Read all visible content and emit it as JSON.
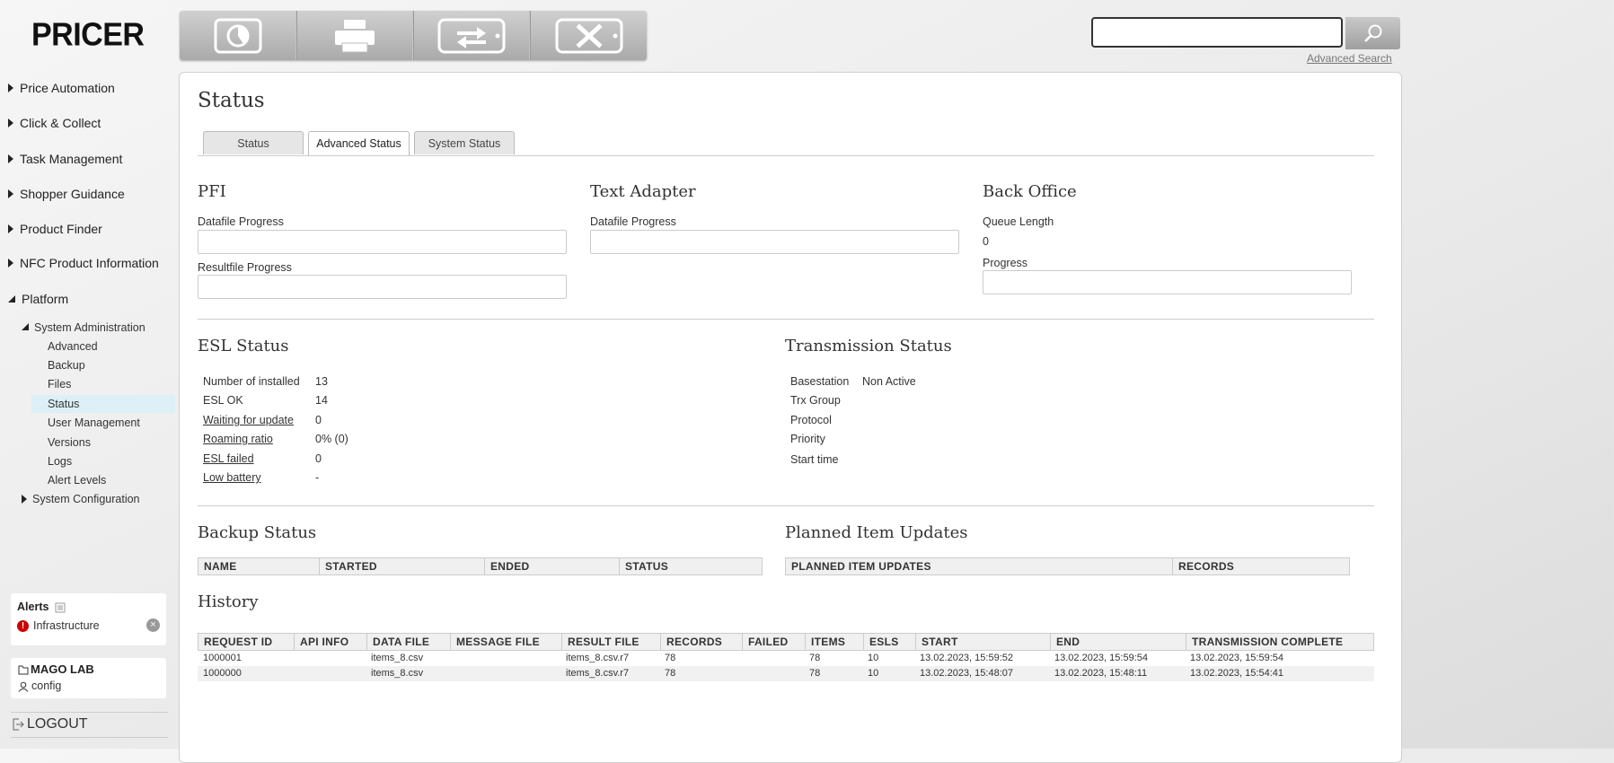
{
  "logo": "PRICER",
  "toolbar": {
    "buttons": [
      {
        "icon": "pie-chart-icon"
      },
      {
        "icon": "printer-icon"
      },
      {
        "icon": "exchange-label-icon"
      },
      {
        "icon": "delete-label-icon"
      }
    ]
  },
  "search": {
    "value": "",
    "placeholder": "",
    "advanced_label": "Advanced Search",
    "icon": "search-icon"
  },
  "nav": {
    "items": [
      {
        "label": "Price Automation"
      },
      {
        "label": "Click & Collect"
      },
      {
        "label": "Task Management"
      },
      {
        "label": "Shopper Guidance"
      },
      {
        "label": "Product Finder"
      },
      {
        "label": "NFC Product Information"
      },
      {
        "label": "Platform"
      }
    ],
    "system_administration": "System Administration",
    "sub_items": [
      {
        "label": "Advanced"
      },
      {
        "label": "Backup"
      },
      {
        "label": "Files"
      },
      {
        "label": "Status"
      },
      {
        "label": "User Management"
      },
      {
        "label": "Versions"
      },
      {
        "label": "Logs"
      },
      {
        "label": "Alert Levels"
      }
    ],
    "system_configuration": "System Configuration"
  },
  "alerts": {
    "title": "Alerts",
    "item": "Infrastructure",
    "badge": "!",
    "close": "×"
  },
  "user": {
    "store": "MAGO LAB",
    "name": "config"
  },
  "logout": "LOGOUT",
  "page": {
    "title": "Status",
    "tabs": [
      {
        "label": "Status"
      },
      {
        "label": "Advanced Status"
      },
      {
        "label": "System Status"
      }
    ]
  },
  "pfi": {
    "title": "PFI",
    "datafile_label": "Datafile Progress",
    "resultfile_label": "Resultfile Progress"
  },
  "text_adapter": {
    "title": "Text Adapter",
    "datafile_label": "Datafile Progress"
  },
  "back_office": {
    "title": "Back Office",
    "queue_label": "Queue Length",
    "queue_value": "0",
    "progress_label": "Progress"
  },
  "esl_status": {
    "title": "ESL Status",
    "rows": [
      {
        "label": "Number of installed",
        "value": "13"
      },
      {
        "label": "ESL OK",
        "value": "14"
      },
      {
        "label": "Waiting for update",
        "value": "0"
      },
      {
        "label": "Roaming ratio",
        "value": "0% (0)"
      },
      {
        "label": "ESL failed",
        "value": "0"
      },
      {
        "label": "Low battery",
        "value": "-"
      }
    ]
  },
  "transmission_status": {
    "title": "Transmission Status",
    "rows": [
      {
        "label": "Basestation",
        "value": "Non Active"
      },
      {
        "label": "Trx Group",
        "value": ""
      },
      {
        "label": "Protocol",
        "value": ""
      },
      {
        "label": "Priority",
        "value": ""
      },
      {
        "label": "Start time",
        "value": ""
      }
    ]
  },
  "backup_status": {
    "title": "Backup Status",
    "columns": [
      "NAME",
      "STARTED",
      "ENDED",
      "STATUS"
    ]
  },
  "planned_updates": {
    "title": "Planned Item Updates",
    "columns": [
      "PLANNED ITEM UPDATES",
      "RECORDS"
    ]
  },
  "history": {
    "title": "History",
    "columns": [
      "REQUEST ID",
      "API INFO",
      "DATA FILE",
      "MESSAGE FILE",
      "RESULT FILE",
      "RECORDS",
      "FAILED",
      "ITEMS",
      "ESLS",
      "START",
      "END",
      "TRANSMISSION COMPLETE"
    ],
    "rows": [
      [
        "1000001",
        "",
        "items_8.csv",
        "",
        "items_8.csv.r7",
        "78",
        "",
        "78",
        "10",
        "13.02.2023, 15:59:52",
        "13.02.2023, 15:59:54",
        "13.02.2023, 15:59:54"
      ],
      [
        "1000000",
        "",
        "items_8.csv",
        "",
        "items_8.csv.r7",
        "78",
        "",
        "78",
        "10",
        "13.02.2023, 15:48:07",
        "13.02.2023, 15:48:11",
        "13.02.2023, 15:54:41"
      ]
    ]
  }
}
